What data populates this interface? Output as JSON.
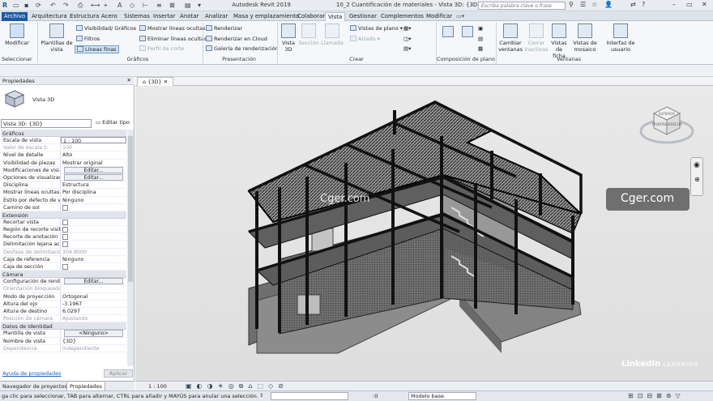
{
  "window": {
    "title": "Autodesk Revit 2019",
    "doc_title": "10_2 Cuantificación de materiales - Vista 3D: {3D}",
    "search_placeholder": "Escriba palabra clave o frase"
  },
  "tabs": [
    "Archivo",
    "Arquitectura",
    "Estructura",
    "Acero",
    "Sistemas",
    "Insertar",
    "Anotar",
    "Analizar",
    "Masa y emplazamiento",
    "Colaborar",
    "Vista",
    "Gestionar",
    "Complementos",
    "Modificar"
  ],
  "ribbon": {
    "modify": "Modificar",
    "select": "Seleccionar",
    "plantillas": "Plantillas de vista",
    "graphics_items": [
      "Visibilidad/ Gráficos",
      "Filtros",
      "Líneas finas"
    ],
    "graphics_items2": [
      "Mostrar líneas ocultas",
      "Eliminar líneas ocultas",
      "Perfil de corte"
    ],
    "group_graficos": "Gráficos",
    "pres_items": [
      "Renderizar",
      "Renderizar en Cloud",
      "Galería de renderización"
    ],
    "group_presentacion": "Presentación",
    "crear_big": [
      "Vista 3D",
      "Sección",
      "Llamada"
    ],
    "crear_small": [
      "Vistas de plano",
      "Alzado"
    ],
    "group_crear": "Crear",
    "comp_label": "Composición de plano",
    "win_items": [
      "Cambiar ventanas",
      "Cerrar inactivas",
      "Vistas de ficha",
      "Vistas de mosaico"
    ],
    "group_ventanas": "Ventanas",
    "ui": "Interfaz de usuario"
  },
  "properties": {
    "header": "Propiedades",
    "type_name": "Vista 3D",
    "selector": "Vista 3D: {3D}",
    "edit_type": "Editar tipo",
    "help": "Ayuda de propiedades",
    "apply": "Aplicar",
    "sections": [
      {
        "title": "Gráficos",
        "rows": [
          [
            "Escala de vista",
            "1 : 100",
            "input"
          ],
          [
            "Valor de escala    1:",
            "100",
            "dis"
          ],
          [
            "Nivel de detalle",
            "Alto",
            ""
          ],
          [
            "Visibilidad de piezas",
            "Mostrar original",
            ""
          ],
          [
            "Modificaciones de visi...",
            "Editar...",
            "btn"
          ],
          [
            "Opciones de visualizac...",
            "Editar...",
            "btn"
          ],
          [
            "Disciplina",
            "Estructura",
            ""
          ],
          [
            "Mostrar líneas ocultas",
            "Por disciplina",
            ""
          ],
          [
            "Estilo por defecto de v...",
            "Ninguno",
            ""
          ],
          [
            "Camino de sol",
            "",
            "chk"
          ]
        ]
      },
      {
        "title": "Extensión",
        "rows": [
          [
            "Recortar vista",
            "",
            "chk"
          ],
          [
            "Región de recorte visible",
            "",
            "chk"
          ],
          [
            "Recorte de anotación",
            "",
            "chk"
          ],
          [
            "Delimitación lejana ac...",
            "",
            "chk"
          ],
          [
            "Desfase de delimitació...",
            "304.8000",
            "dis"
          ],
          [
            "Caja de referencia",
            "Ninguno",
            ""
          ],
          [
            "Caja de sección",
            "",
            "chk"
          ]
        ]
      },
      {
        "title": "Cámara",
        "rows": [
          [
            "Configuración de rend...",
            "Editar...",
            "btn"
          ],
          [
            "Orientación bloqueada",
            "",
            "dis"
          ],
          [
            "Modo de proyección",
            "Ortogonal",
            ""
          ],
          [
            "Altura del ojo",
            "-3.1967",
            ""
          ],
          [
            "Altura de destino",
            "6.0297",
            ""
          ],
          [
            "Posición de cámara",
            "Ajustando",
            "dis"
          ]
        ]
      },
      {
        "title": "Datos de identidad",
        "rows": [
          [
            "Plantilla de vista",
            "<Ninguno>",
            "btn"
          ],
          [
            "Nombre de vista",
            "{3D}",
            ""
          ],
          [
            "Dependencia",
            "Independiente",
            "dis"
          ]
        ]
      }
    ]
  },
  "bottom_tabs": [
    "Navegador de proyectos...",
    "Propiedades"
  ],
  "view": {
    "tab": "{3D}",
    "scale": "1 : 100",
    "cube_labels": [
      "SUPERIOR",
      "FRONTAL",
      "DERECHA"
    ]
  },
  "watermarks": [
    "Cger.com",
    "Cger.com",
    "LinkedIn",
    "LEARNING"
  ],
  "status": {
    "message": "ga clic para seleccionar, TAB para alternar, CTRL para añadir y MAYÚS para anular una selección.",
    "model": "Modelo base",
    "zero": ":0"
  }
}
